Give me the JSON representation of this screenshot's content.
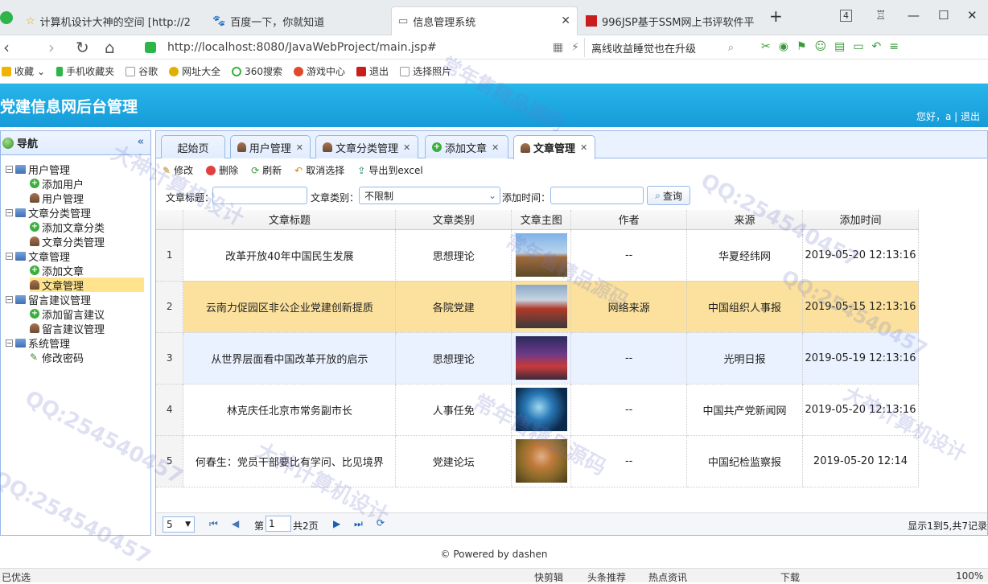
{
  "browser": {
    "tabs": [
      {
        "label": "计算机设计大神的空间 [http://2"
      },
      {
        "label": "百度一下，你就知道"
      },
      {
        "label": "信息管理系统"
      },
      {
        "label": "996JSP基于SSM网上书评软件平"
      }
    ],
    "tab_count": "4",
    "url": "http://localhost:8080/JavaWebProject/main.jsp#",
    "search_text": "离线收益睡觉也在升级"
  },
  "bookmarks": [
    "收藏",
    "手机收藏夹",
    "谷歌",
    "网址大全",
    "360搜索",
    "游戏中心",
    "退出",
    "选择照片"
  ],
  "app": {
    "title": "党建信息网后台管理",
    "welcome": "您好，a | 退出"
  },
  "sidebar": {
    "title": "导航",
    "tree": [
      {
        "label": "用户管理",
        "icon": "folder-icon",
        "level": 0
      },
      {
        "label": "添加用户",
        "icon": "add-icon",
        "level": 1
      },
      {
        "label": "用户管理",
        "icon": "user-icon",
        "level": 1
      },
      {
        "label": "文章分类管理",
        "icon": "folder-icon",
        "level": 0
      },
      {
        "label": "添加文章分类",
        "icon": "add-icon",
        "level": 1
      },
      {
        "label": "文章分类管理",
        "icon": "user-icon",
        "level": 1
      },
      {
        "label": "文章管理",
        "icon": "folder-icon",
        "level": 0
      },
      {
        "label": "添加文章",
        "icon": "add-icon",
        "level": 1
      },
      {
        "label": "文章管理",
        "icon": "user-icon",
        "level": 1,
        "selected": true
      },
      {
        "label": "留言建议管理",
        "icon": "folder-icon",
        "level": 0
      },
      {
        "label": "添加留言建议",
        "icon": "add-icon",
        "level": 1
      },
      {
        "label": "留言建议管理",
        "icon": "user-icon",
        "level": 1
      },
      {
        "label": "系统管理",
        "icon": "folder-icon",
        "level": 0
      },
      {
        "label": "修改密码",
        "icon": "pencil-icon",
        "level": 1
      }
    ]
  },
  "panel_tabs": [
    {
      "label": "起始页"
    },
    {
      "label": "用户管理"
    },
    {
      "label": "文章分类管理"
    },
    {
      "label": "添加文章"
    },
    {
      "label": "文章管理",
      "active": true
    }
  ],
  "toolbar": {
    "edit": "修改",
    "delete": "删除",
    "refresh": "刷新",
    "unselect": "取消选择",
    "export": "导出到excel"
  },
  "filters": {
    "title_label": "文章标题：",
    "title_value": "",
    "category_label": "文章类别：",
    "category_value": "不限制",
    "time_label": "添加时间：",
    "time_value": "",
    "query": "查询"
  },
  "grid": {
    "columns": [
      "文章标题",
      "文章类别",
      "文章主图",
      "作者",
      "来源",
      "添加时间"
    ],
    "rows": [
      {
        "n": "1",
        "title": "改革开放40年中国民生发展",
        "category": "思想理论",
        "author": "--",
        "source": "华夏经纬网",
        "time": "2019-05-20 12:13:16"
      },
      {
        "n": "2",
        "title": "云南力促园区非公企业党建创新提质",
        "category": "各院党建",
        "author": "网络来源",
        "source": "中国组织人事报",
        "time": "2019-05-15 12:13:16"
      },
      {
        "n": "3",
        "title": "从世界层面看中国改革开放的启示",
        "category": "思想理论",
        "author": "--",
        "source": "光明日报",
        "time": "2019-05-19 12:13:16"
      },
      {
        "n": "4",
        "title": "林克庆任北京市常务副市长",
        "category": "人事任免",
        "author": "--",
        "source": "中国共产党新闻网",
        "time": "2019-05-20 12:13:16"
      },
      {
        "n": "5",
        "title": "何春生：党员干部要比有学问、比见境界",
        "category": "党建论坛",
        "author": "--",
        "source": "中国纪检监察报",
        "time": "2019-05-20 12:14"
      }
    ]
  },
  "pager": {
    "page_size": "5",
    "page_label": "第",
    "page_value": "1",
    "total_pages": "共2页",
    "summary": "显示1到5,共7记录"
  },
  "footer": "© Powered by dashen",
  "statusbar": {
    "left": "已优选",
    "items": [
      "快剪辑",
      "头条推荐",
      "热点资讯",
      "下载",
      "100%"
    ]
  },
  "watermarks": [
    "大神计算机设计",
    "常年售精品源码",
    "QQ:254540457",
    "QQ:254540457",
    "大神计算机设计",
    "常年售精品源码",
    "QQ:254540457",
    "常年售精品源码",
    "大神计算机设计",
    "QQ:254540457"
  ],
  "colors": {
    "header": "#1aa6dd",
    "highlight_row": "#fbe19d",
    "alt_row": "#eaf2ff",
    "border": "#95b8e7"
  }
}
